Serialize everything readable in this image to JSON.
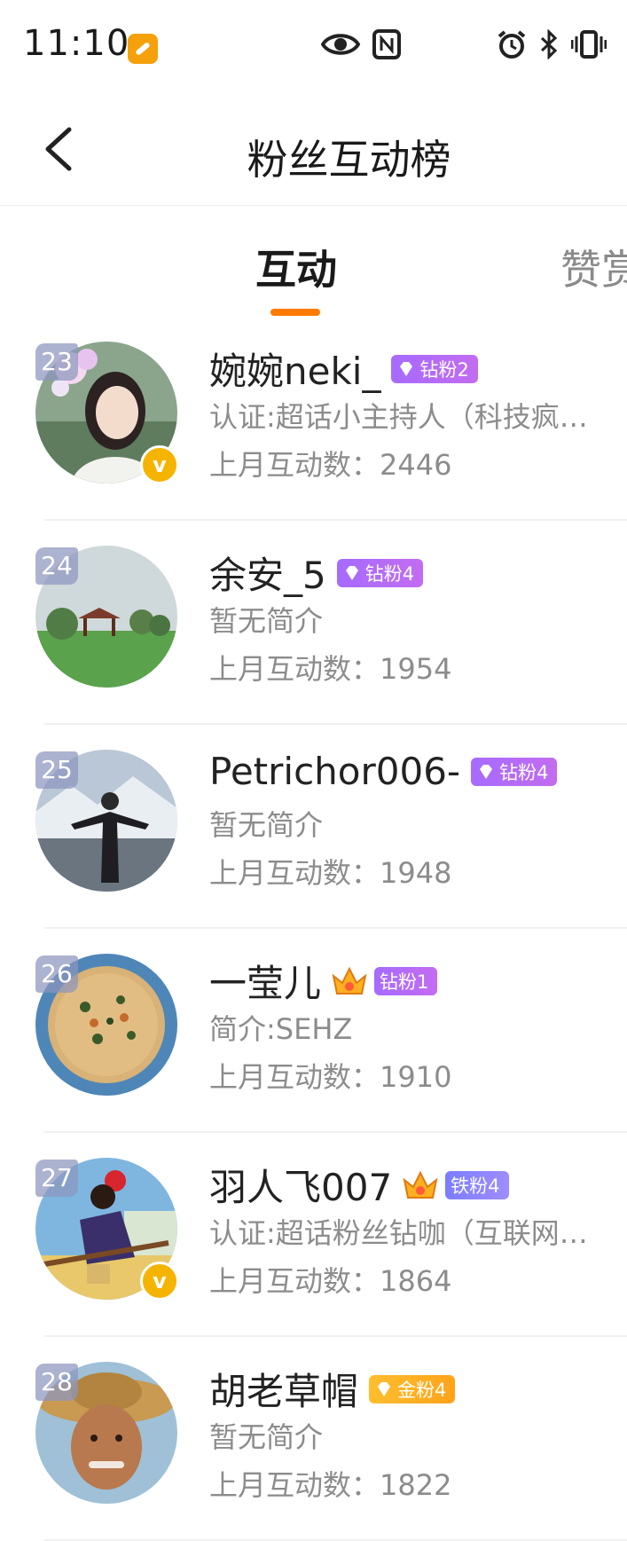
{
  "status_bar": {
    "time": "11:10",
    "icons": [
      "app-notification-icon",
      "eye-icon",
      "nfc-icon",
      "alarm-icon",
      "bluetooth-icon",
      "vibrate-icon"
    ]
  },
  "header": {
    "back_icon": "chevron-left-icon",
    "title": "粉丝互动榜"
  },
  "tabs": [
    {
      "label": "互动",
      "active": true
    },
    {
      "label": "赞赏",
      "active": false
    }
  ],
  "colors": {
    "accent": "#ff7a00",
    "verified": "#f5b400",
    "rank_badge": "#8c96be"
  },
  "fans": [
    {
      "rank": "23",
      "name": "婉婉neki_",
      "badge": "钻粉2",
      "badge_style": "purple",
      "badge_icon": "diamond-icon",
      "bio": "认证:超话小主持人（科技疯…",
      "count_label": "上月互动数：",
      "count": "2446",
      "verified": true,
      "avatar": "portrait-woman-flowers"
    },
    {
      "rank": "24",
      "name": "余安_5",
      "badge": "钻粉4",
      "badge_style": "purple",
      "badge_icon": "diamond-icon",
      "bio": "暂无简介",
      "count_label": "上月互动数：",
      "count": "1954",
      "verified": false,
      "avatar": "landscape-pavilion"
    },
    {
      "rank": "25",
      "name": "Petrichor006-",
      "badge": "钻粉4",
      "badge_style": "purple",
      "badge_icon": "diamond-icon",
      "bio": "暂无简介",
      "count_label": "上月互动数：",
      "count": "1948",
      "verified": false,
      "avatar": "man-mountains"
    },
    {
      "rank": "26",
      "name": "一莹儿",
      "badge": "钻粉1",
      "badge_style": "purple",
      "badge_icon": "crown-icon",
      "bio": "简介:SEHZ",
      "count_label": "上月互动数：",
      "count": "1910",
      "verified": false,
      "avatar": "food-pancake"
    },
    {
      "rank": "27",
      "name": "羽人飞007",
      "badge": "铁粉4",
      "badge_style": "blue",
      "badge_icon": "crown-icon",
      "bio": "认证:超话粉丝钻咖（互联网…",
      "count_label": "上月互动数：",
      "count": "1864",
      "verified": true,
      "avatar": "cartoon-witch"
    },
    {
      "rank": "28",
      "name": "胡老草帽",
      "badge": "金粉4",
      "badge_style": "gold",
      "badge_icon": "diamond-icon",
      "bio": "暂无简介",
      "count_label": "上月互动数：",
      "count": "1822",
      "verified": false,
      "avatar": "man-straw-hat"
    }
  ]
}
